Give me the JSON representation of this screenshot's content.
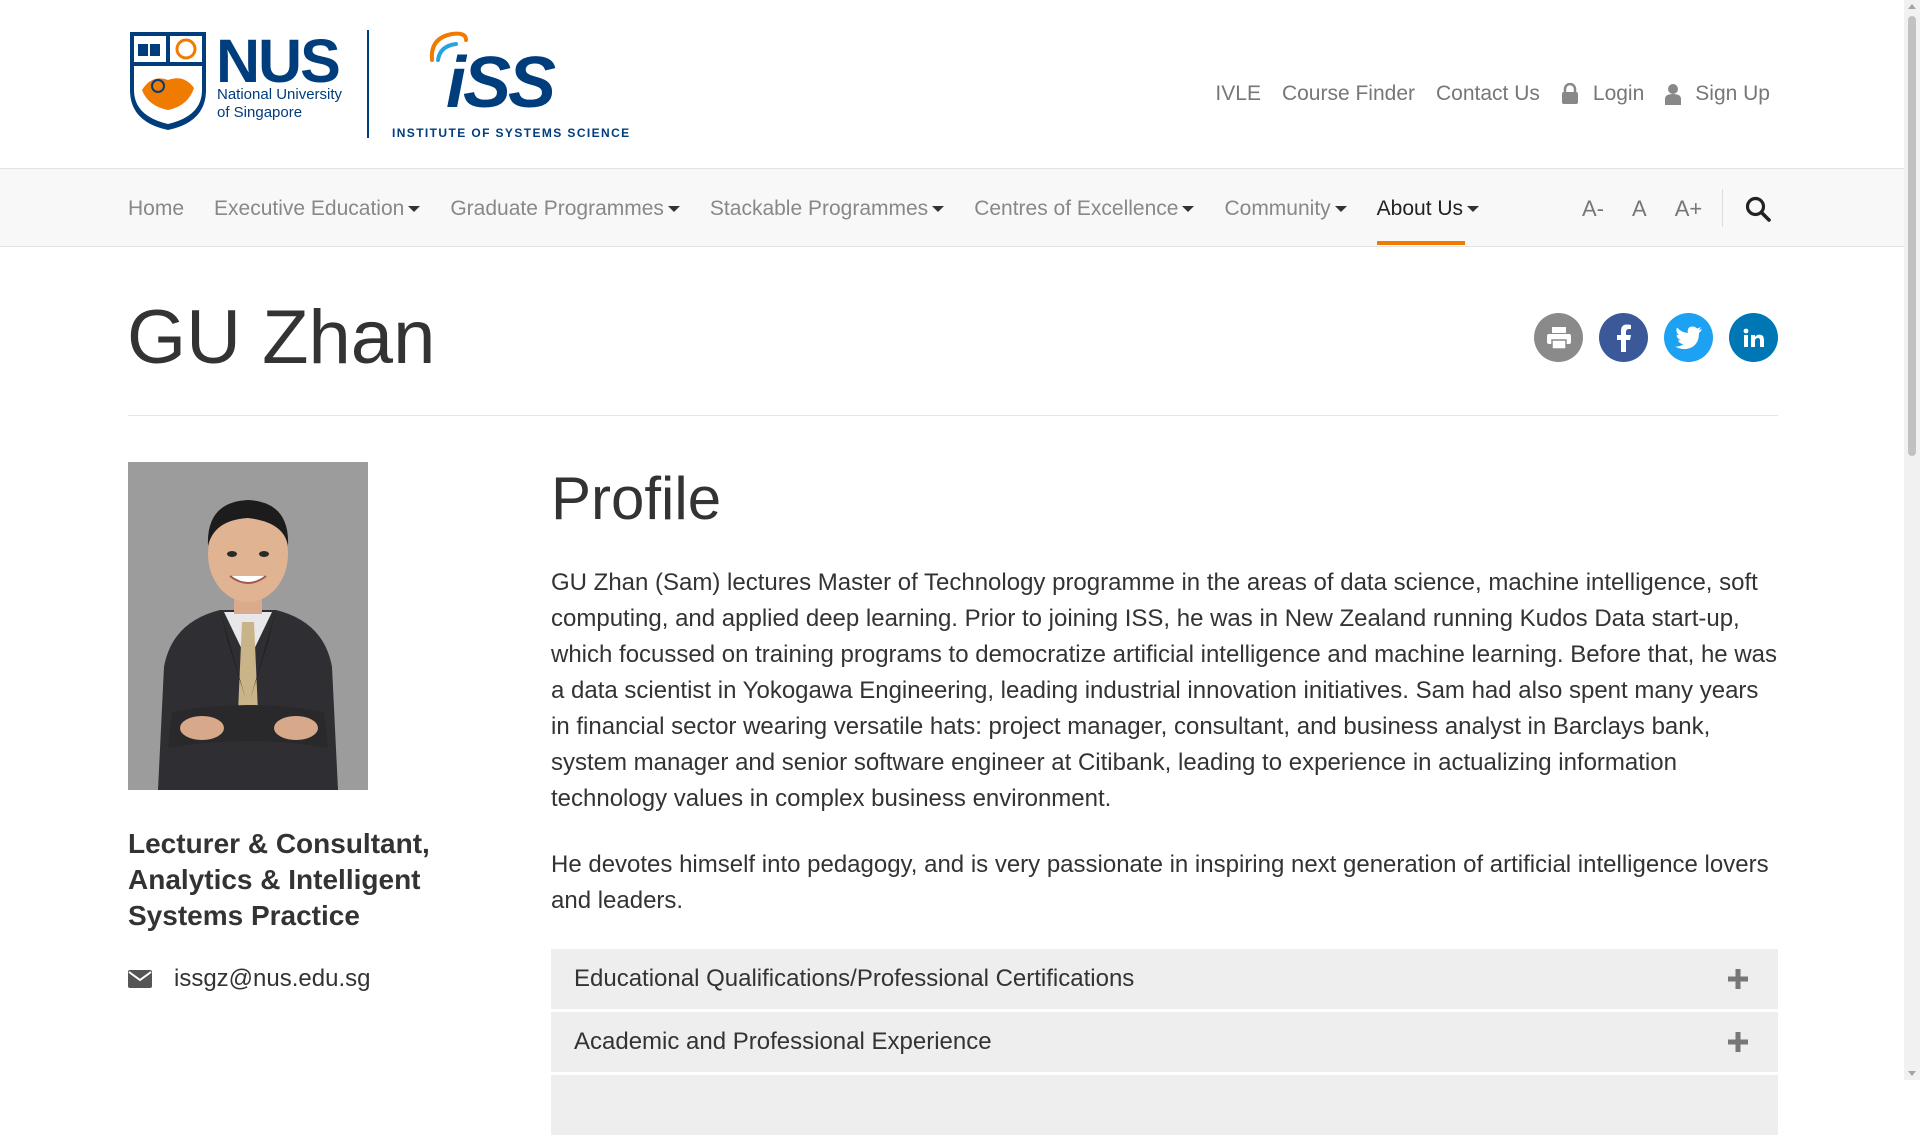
{
  "logo": {
    "nus_text": "NUS",
    "nus_line1": "National University",
    "nus_line2": "of Singapore",
    "iss_text": "iSS",
    "iss_subtitle": "INSTITUTE OF SYSTEMS SCIENCE"
  },
  "top_links": {
    "ivle": "IVLE",
    "course_finder": "Course Finder",
    "contact_us": "Contact Us",
    "login": "Login",
    "sign_up": "Sign Up"
  },
  "nav": {
    "items": [
      {
        "label": "Home",
        "has_caret": false
      },
      {
        "label": "Executive Education",
        "has_caret": true
      },
      {
        "label": "Graduate Programmes",
        "has_caret": true
      },
      {
        "label": "Stackable Programmes",
        "has_caret": true
      },
      {
        "label": "Centres of Excellence",
        "has_caret": true
      },
      {
        "label": "Community",
        "has_caret": true
      },
      {
        "label": "About Us",
        "has_caret": true,
        "active": true
      }
    ],
    "font_decrease": "A-",
    "font_normal": "A",
    "font_increase": "A+",
    "accent_color": "#ef7c00"
  },
  "page": {
    "title": "GU Zhan",
    "share_icons": [
      "print-icon",
      "facebook-icon",
      "twitter-icon",
      "linkedin-icon"
    ]
  },
  "person": {
    "position": "Lecturer & Consultant, Analytics & Intelligent Systems Practice",
    "email": "issgz@nus.edu.sg"
  },
  "profile": {
    "heading": "Profile",
    "paragraph1": "GU Zhan (Sam) lectures Master of Technology programme in the areas of data science, machine intelligence, soft computing, and applied deep learning. Prior to joining ISS, he was in New Zealand running Kudos Data start-up, which focussed on training programs to democratize artificial intelligence and machine learning.  Before that, he was a data scientist in Yokogawa Engineering, leading industrial innovation initiatives.  Sam had also spent many years in financial sector wearing versatile hats: project manager, consultant, and business analyst in Barclays bank, system manager and senior software engineer at Citibank, leading to experience in actualizing information technology values in complex business environment.",
    "paragraph2": "He devotes himself into pedagogy, and is very passionate in inspiring next generation of artificial intelligence lovers and leaders."
  },
  "accordion": [
    {
      "label": "Educational Qualifications/Professional Certifications"
    },
    {
      "label": "Academic and Professional Experience"
    }
  ],
  "colors": {
    "nus_blue": "#003d7c",
    "nus_orange": "#ef7c00",
    "facebook": "#3b5998",
    "twitter": "#1da1f2",
    "linkedin": "#0077b5",
    "print": "#8a8a8a"
  }
}
